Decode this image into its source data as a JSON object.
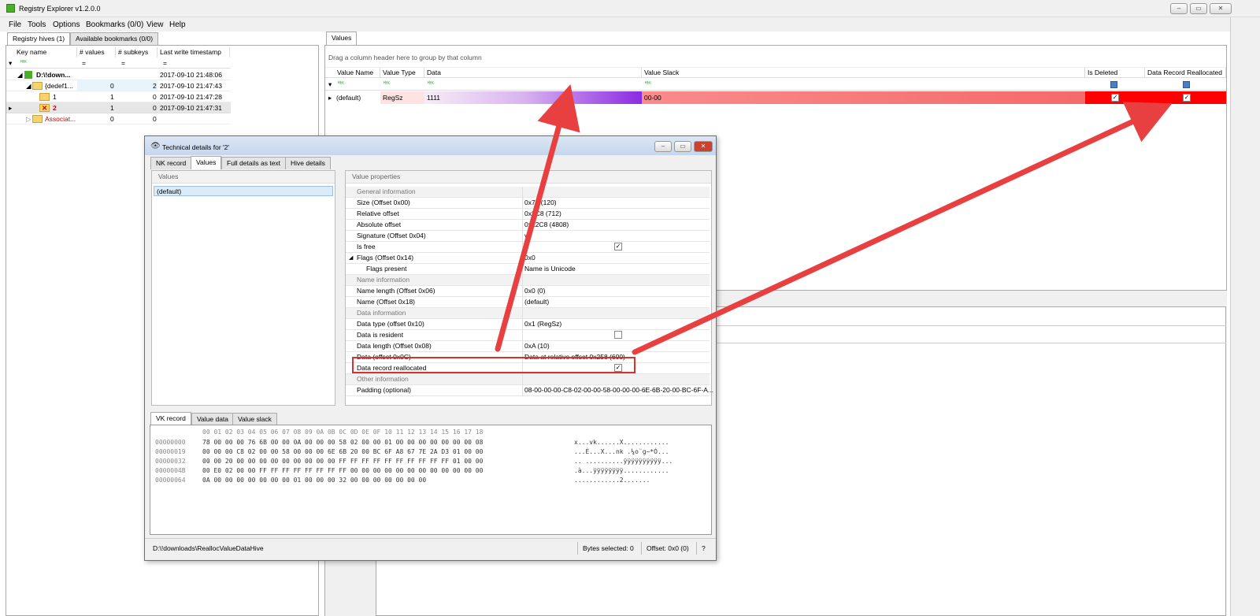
{
  "app": {
    "title": "Registry Explorer v1.2.0.0"
  },
  "menu": [
    "File",
    "Tools",
    "Options",
    "Bookmarks (0/0)",
    "View",
    "Help"
  ],
  "left_tabs": [
    "Registry hives (1)",
    "Available bookmarks (0/0)"
  ],
  "tree": {
    "columns": [
      "Key name",
      "# values",
      "# subkeys",
      "Last write timestamp"
    ],
    "rows": [
      {
        "name": "D:\\!down...",
        "values": "",
        "subkeys": "",
        "ts": "2017-09-10 21:48:06"
      },
      {
        "name": "{dedef1...",
        "values": "0",
        "subkeys": "2",
        "ts": "2017-09-10 21:47:43"
      },
      {
        "name": "1",
        "values": "1",
        "subkeys": "0",
        "ts": "2017-09-10 21:47:28"
      },
      {
        "name": "2",
        "values": "1",
        "subkeys": "0",
        "ts": "2017-09-10 21:47:31"
      },
      {
        "name": "Associat...",
        "values": "0",
        "subkeys": "0",
        "ts": ""
      }
    ]
  },
  "values_tab": "Values",
  "group_hint": "Drag a column header here to group by that column",
  "values_grid": {
    "columns": [
      "Value Name",
      "Value Type",
      "Data",
      "Value Slack",
      "Is Deleted",
      "Data Record Reallocated"
    ],
    "row": {
      "name": "(default)",
      "type": "RegSz",
      "data": "1111",
      "slack": "00-00"
    }
  },
  "dialog": {
    "title": "Technical details for '2'",
    "tabs": [
      "NK record",
      "Values",
      "Full details as text",
      "Hive details"
    ],
    "values_header": "Values",
    "values_item": "(default)",
    "props_header": "Value properties",
    "props": [
      {
        "n": "General information",
        "cat": true
      },
      {
        "n": "Size (Offset 0x00)",
        "v": "0x78 (120)"
      },
      {
        "n": "Relative offset",
        "v": "0x2C8 (712)"
      },
      {
        "n": "Absolute offset",
        "v": "0x12C8 (4808)"
      },
      {
        "n": "Signature (Offset 0x04)",
        "v": "vk"
      },
      {
        "n": "Is free",
        "v": "",
        "cb": "on"
      },
      {
        "n": "Flags (Offset 0x14)",
        "v": "0x0",
        "exp": true
      },
      {
        "n": "Flags present",
        "v": "Name is Unicode",
        "sub": true
      },
      {
        "n": "Name information",
        "cat": true
      },
      {
        "n": "Name length (Offset 0x06)",
        "v": "0x0 (0)"
      },
      {
        "n": "Name (Offset 0x18)",
        "v": "(default)"
      },
      {
        "n": "Data information",
        "cat": true
      },
      {
        "n": "Data type (offset 0x10)",
        "v": "0x1 (RegSz)"
      },
      {
        "n": "Data is resident",
        "v": "",
        "cb": "off"
      },
      {
        "n": "Data length (Offset 0x08)",
        "v": "0xA (10)"
      },
      {
        "n": "Data (offset 0x0C)",
        "v": "Data at relative offset 0x258 (600)"
      },
      {
        "n": "Data record reallocated",
        "v": "",
        "cb": "on"
      },
      {
        "n": "Other information",
        "cat": true
      },
      {
        "n": "Padding (optional)",
        "v": "08-00-00-00-C8-02-00-00-58-00-00-00-6E-6B-20-00-BC-6F-A..."
      }
    ],
    "hex_tabs": [
      "VK record",
      "Value data",
      "Value slack"
    ],
    "hex_header": "00 01 02 03 04 05 06 07 08 09 0A 0B 0C 0D 0E 0F 10 11 12 13 14 15 16 17 18",
    "hex_lines": [
      {
        "off": "00000000",
        "bytes": "78 00 00 00 76 6B 00 00 0A 00 00 00 58 02 00 00 01 00 00 00 00 00 00 00 08",
        "ascii": "x...vk......X............"
      },
      {
        "off": "00000019",
        "bytes": "00 00 00 C8 02 00 00 58 00 00 00 6E 6B 20 00 BC 6F A8 67 7E 2A D3 01 00 00",
        "ascii": "...È...X...nk .¼o¨g~*Ó..."
      },
      {
        "off": "00000032",
        "bytes": "00 00 20 00 00 00 00 00 00 00 00 00 FF FF FF FF FF FF FF FF FF FF 01 00 00",
        "ascii": ".. ..........ÿÿÿÿÿÿÿÿÿÿ..."
      },
      {
        "off": "0000004B",
        "bytes": "00 E0 02 00 00 FF FF FF FF FF FF FF FF 00 00 00 00 00 00 00 00 00 00 00 00",
        "ascii": ".à...ÿÿÿÿÿÿÿÿ............"
      },
      {
        "off": "00000064",
        "bytes": "0A 00 00 00 00 00 00 00 01 00 00 00 32 00 00 00 00 00 00 00",
        "ascii": "............2......."
      }
    ],
    "status": {
      "path": "D:\\!downloads\\ReallocValueDataHive",
      "bytes": "Bytes selected: 0",
      "offset": "Offset: 0x0 (0)",
      "help": "?"
    }
  },
  "colors": {
    "highlight_red": "#ff0000",
    "arrow": "#e84040",
    "purple": "#8b2be2"
  }
}
